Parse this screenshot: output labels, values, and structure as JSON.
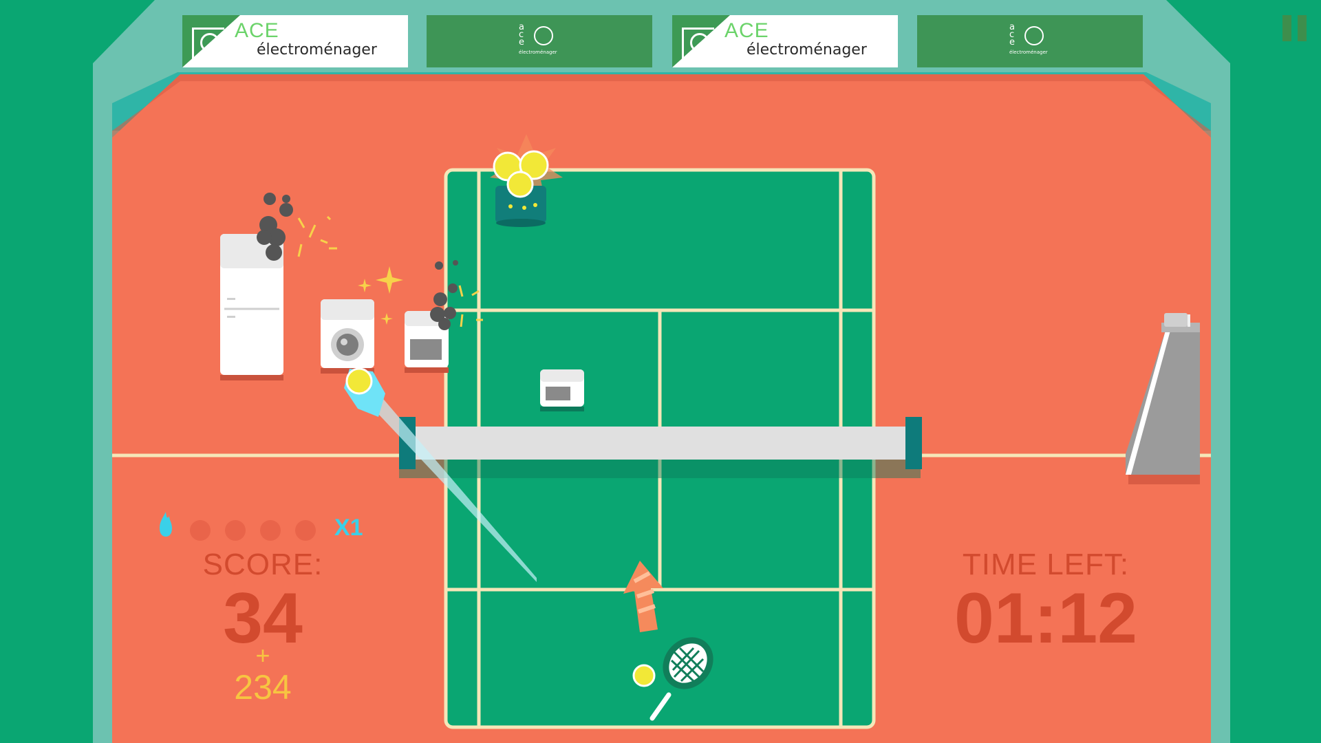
{
  "banners": [
    {
      "style": "white",
      "brand": "ACE",
      "subtitle": "électroménager"
    },
    {
      "style": "dark",
      "mini_letters": "a c e",
      "mini_sub": "électroménager"
    },
    {
      "style": "white",
      "brand": "ACE",
      "subtitle": "électroménager"
    },
    {
      "style": "dark",
      "mini_letters": "a c e",
      "mini_sub": "électroménager"
    }
  ],
  "hud": {
    "score_label": "SCORE:",
    "score_value": "34",
    "bonus_plus": "+",
    "bonus_value": "234",
    "multiplier": "X1",
    "streak_filled": 0,
    "streak_total": 4,
    "time_label": "TIME LEFT:",
    "time_value": "01:12"
  },
  "icons": {
    "pause": "pause-icon",
    "flame": "flame-icon",
    "racket": "tennis-racket-icon",
    "ball": "tennis-ball-icon"
  },
  "colors": {
    "court_green": "#0aa672",
    "clay": "#f47356",
    "wall": "#6cc2b0",
    "wall_inner": "#2fb5a7",
    "line": "#f5e6b8",
    "hud_text": "#d24a2e",
    "bonus_text": "#f7c541",
    "multiplier": "#3ad0e8"
  }
}
